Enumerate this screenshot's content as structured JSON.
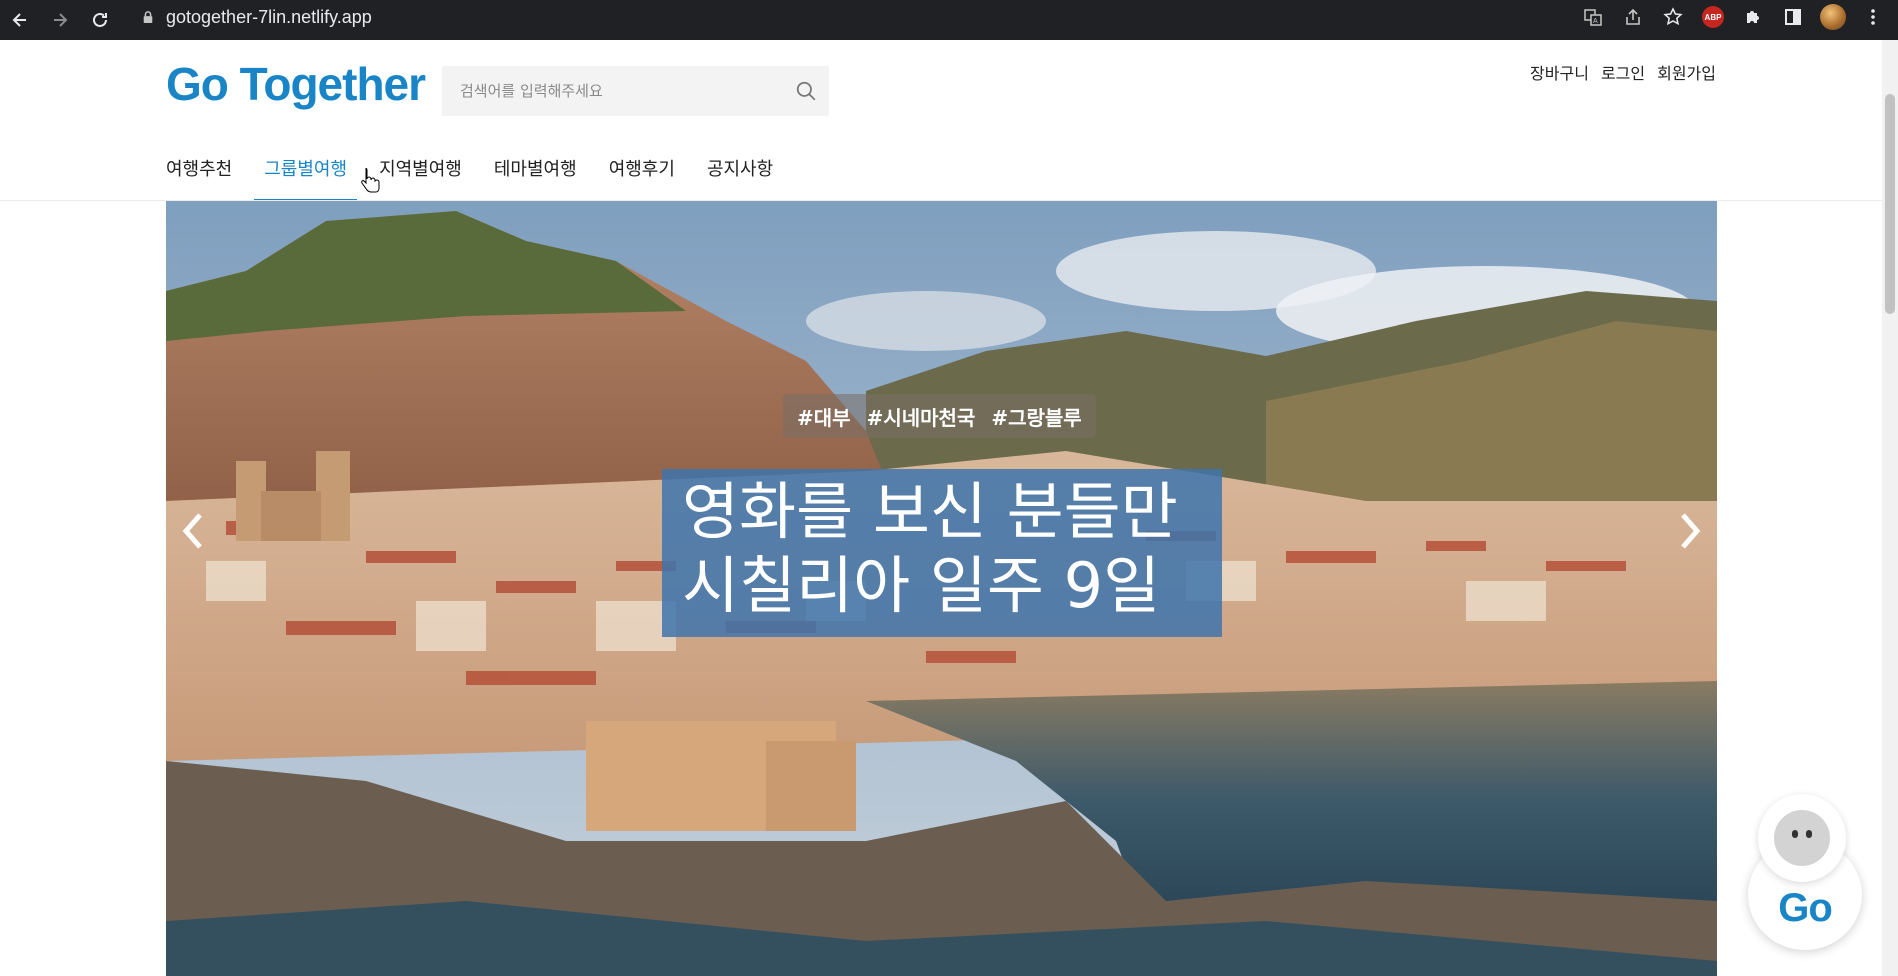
{
  "browser": {
    "url": "gotogether-7lin.netlify.app",
    "extension_badge": "ABP"
  },
  "site": {
    "logo_text": "Go Together",
    "chatbot_logo": "Go"
  },
  "search": {
    "placeholder": "검색어를 입력해주세요"
  },
  "utility": {
    "cart": "장바구니",
    "login": "로그인",
    "signup": "회원가입"
  },
  "nav": {
    "items": [
      {
        "label": "여행추천"
      },
      {
        "label": "그룹별여행"
      },
      {
        "label": "지역별여행"
      },
      {
        "label": "테마별여행"
      },
      {
        "label": "여행후기"
      },
      {
        "label": "공지사항"
      }
    ],
    "active_index": 1
  },
  "hero": {
    "tags": [
      "#대부",
      "#시네마천국",
      "#그랑블루"
    ],
    "title_line1": "영화를 보신 분들만",
    "title_line2": "시칠리아 일주 9일"
  },
  "colors": {
    "brand": "#1a85c6",
    "accent": "#f2a31b",
    "headline_bg": "#3e74ad"
  },
  "icons": [
    "back-icon",
    "forward-icon",
    "reload-icon",
    "lock-icon",
    "translate-icon",
    "share-icon",
    "star-icon",
    "puzzle-icon",
    "sidepanel-icon",
    "menu-icon",
    "search-icon",
    "chevron-left-icon",
    "chevron-right-icon",
    "cursor-icon"
  ]
}
